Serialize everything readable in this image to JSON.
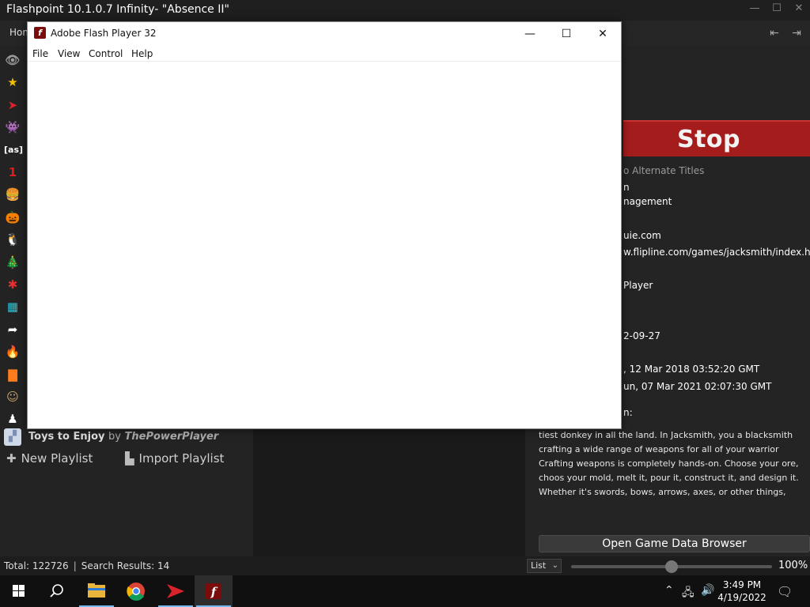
{
  "launcher": {
    "title": "Flashpoint 10.1.0.7 Infinity- \"Absence II\"",
    "home_tab": "Hom",
    "playlists": [
      {
        "icon": "eye-icon",
        "glyph": "👁",
        "color": "#9a9a9a"
      },
      {
        "icon": "star-icon",
        "glyph": "★",
        "color": "#f2c200"
      },
      {
        "icon": "flashpoint-arrow-icon",
        "glyph": "➤",
        "color": "#d8232a"
      },
      {
        "icon": "space-invader-icon",
        "glyph": "👾",
        "color": "#ffffff"
      },
      {
        "icon": "as-tag-icon",
        "glyph": "[as]",
        "color": "#ffffff"
      },
      {
        "icon": "number-one-icon",
        "glyph": "1",
        "color": "#e21b1b"
      },
      {
        "icon": "burger-icon",
        "glyph": "🍔",
        "color": "#e0a040"
      },
      {
        "icon": "pumpkin-icon",
        "glyph": "🎃",
        "color": "#f07a10"
      },
      {
        "icon": "penguin-icon",
        "glyph": "🐧",
        "color": "#ffffff"
      },
      {
        "icon": "christmas-tree-icon",
        "glyph": "🎄",
        "color": "#2e9e2e"
      },
      {
        "icon": "red-game-icon",
        "glyph": "✱",
        "color": "#e53030"
      },
      {
        "icon": "pixel-grid-icon",
        "glyph": "▦",
        "color": "#2ec7d6"
      },
      {
        "icon": "share-arrow-icon",
        "glyph": "➦",
        "color": "#ffffff"
      },
      {
        "icon": "flame-icon",
        "glyph": "🔥",
        "color": "#ff6a00"
      },
      {
        "icon": "audio-bars-icon",
        "glyph": "▇",
        "color": "#ff7b1c"
      },
      {
        "icon": "character-portrait-icon",
        "glyph": "☺",
        "color": "#c9a46a"
      },
      {
        "icon": "silhouette-icon",
        "glyph": "♟",
        "color": "#ffffff"
      }
    ],
    "highlight_playlist": {
      "name": "Toys to Enjoy",
      "by": "by",
      "author": "ThePowerPlayer"
    },
    "new_playlist": "New Playlist",
    "import_playlist": "Import Playlist",
    "game": {
      "logo_text": "Stop",
      "alternate_titles": "o Alternate Titles",
      "lines": [
        {
          "text": "n",
          "dim": false
        },
        {
          "text": "nagement",
          "dim": false
        },
        {
          "text": "uie.com",
          "dim": false
        },
        {
          "text": "w.flipline.com/games/jacksmith/index.htr",
          "dim": false
        },
        {
          "text": "Player",
          "dim": false
        },
        {
          "text": "2-09-27",
          "dim": false
        },
        {
          "text": ", 12 Mar 2018 03:52:20 GMT",
          "dim": false
        },
        {
          "text": "un, 07 Mar 2021 02:07:30 GMT",
          "dim": false
        },
        {
          "text": "n:",
          "dim": false
        }
      ],
      "description": "tiest donkey in all the land. In Jacksmith, you a blacksmith crafting a wide range of weapons for all of your warrior Crafting weapons is completely hands-on. Choose your ore, choos your mold, melt it, pour it, construct it, and design it. Whether it's swords, bows, arrows, axes, or other things, you'll need skills and strategy to make the perfect weapon. After crafting, it's off to batt with your team of warriors. As they fight, you gather loot and man",
      "open_browser": "Open Game Data Browser"
    },
    "status": {
      "total": "Total: 122726",
      "separator": "|",
      "results": "Search Results: 14",
      "view_mode": "List",
      "zoom": "100%",
      "zoom_level": 0.5
    }
  },
  "flash_player": {
    "title": "Adobe Flash Player 32",
    "logo_letter": "f",
    "menu": [
      "File",
      "View",
      "Control",
      "Help"
    ],
    "controls": {
      "minimize": "—",
      "maximize": "☐",
      "close": "✕"
    }
  },
  "taskbar": {
    "time": "3:49 PM",
    "date": "4/19/2022",
    "colors": {
      "accent": "#76b9ed",
      "flash_red": "#7a0c0c"
    }
  }
}
